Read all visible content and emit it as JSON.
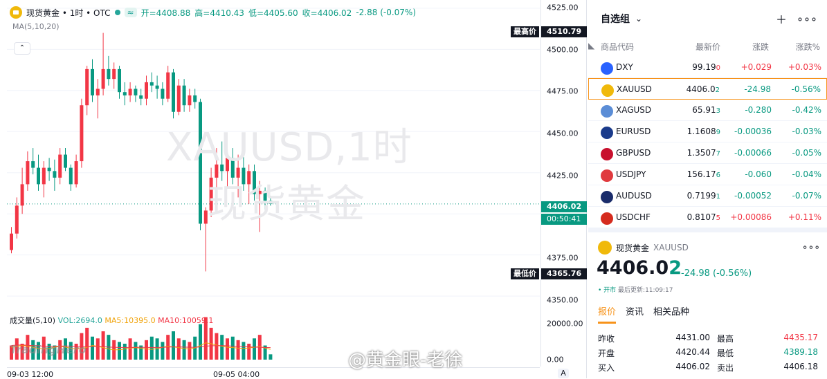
{
  "legend": {
    "title": "现货黄金 • 1时 • OTC",
    "badge": "≈",
    "open": "开=4408.88",
    "high": "高=4410.43",
    "low": "低=4405.60",
    "close": "收=4406.02",
    "change": "-2.88 (-0.07%)"
  },
  "ma_label": "MA(5,10,20)",
  "collapse": "⌃",
  "watermark": {
    "line1": "XAUUSD,1时",
    "line2": "现货黄金"
  },
  "price_axis": {
    "ticks": [
      "4525.00",
      "4500.00",
      "4475.00",
      "4450.00",
      "4425.00",
      "4375.00",
      "4350.00"
    ],
    "high_label": "最高价",
    "high_value": "4510.79",
    "last_value": "4406.02",
    "countdown": "00:50:41",
    "low_label": "最低价",
    "low_value": "4365.76",
    "vol_ticks": [
      "20000.00",
      "0.00"
    ]
  },
  "volume_legend": {
    "title": "成交量(5,10)",
    "vol": "VOL:2694.0",
    "ma5": "MA5:10395.0",
    "ma10": "MA10:10059.1"
  },
  "time_axis": [
    "09-03 12:00",
    "09-05 04:00"
  ],
  "tv_logo": "TradingHero",
  "weibo": "@黄金眼-老徐",
  "axis_button": "A",
  "colors": {
    "up": "#f23645",
    "down": "#089981",
    "accent": "#f7931a"
  },
  "chart_data": {
    "type": "candlestick",
    "symbol": "XAUUSD",
    "timeframe": "1时",
    "ylim": [
      4345,
      4530
    ],
    "candles": [
      {
        "o": 4378,
        "h": 4392,
        "l": 4376,
        "c": 4388
      },
      {
        "o": 4388,
        "h": 4410,
        "l": 4385,
        "c": 4405
      },
      {
        "o": 4405,
        "h": 4428,
        "l": 4400,
        "c": 4418
      },
      {
        "o": 4418,
        "h": 4438,
        "l": 4414,
        "c": 4432
      },
      {
        "o": 4432,
        "h": 4440,
        "l": 4424,
        "c": 4428
      },
      {
        "o": 4428,
        "h": 4436,
        "l": 4414,
        "c": 4418
      },
      {
        "o": 4418,
        "h": 4432,
        "l": 4410,
        "c": 4428
      },
      {
        "o": 4428,
        "h": 4434,
        "l": 4420,
        "c": 4426
      },
      {
        "o": 4426,
        "h": 4433,
        "l": 4414,
        "c": 4422
      },
      {
        "o": 4422,
        "h": 4440,
        "l": 4418,
        "c": 4436
      },
      {
        "o": 4436,
        "h": 4440,
        "l": 4426,
        "c": 4428
      },
      {
        "o": 4428,
        "h": 4430,
        "l": 4414,
        "c": 4418
      },
      {
        "o": 4418,
        "h": 4436,
        "l": 4416,
        "c": 4432
      },
      {
        "o": 4432,
        "h": 4470,
        "l": 4428,
        "c": 4466
      },
      {
        "o": 4466,
        "h": 4490,
        "l": 4460,
        "c": 4488
      },
      {
        "o": 4488,
        "h": 4494,
        "l": 4468,
        "c": 4472
      },
      {
        "o": 4472,
        "h": 4482,
        "l": 4458,
        "c": 4476
      },
      {
        "o": 4476,
        "h": 4510,
        "l": 4472,
        "c": 4488
      },
      {
        "o": 4488,
        "h": 4496,
        "l": 4478,
        "c": 4482
      },
      {
        "o": 4482,
        "h": 4492,
        "l": 4476,
        "c": 4488
      },
      {
        "o": 4488,
        "h": 4490,
        "l": 4470,
        "c": 4474
      },
      {
        "o": 4474,
        "h": 4480,
        "l": 4466,
        "c": 4472
      },
      {
        "o": 4472,
        "h": 4480,
        "l": 4468,
        "c": 4476
      },
      {
        "o": 4476,
        "h": 4478,
        "l": 4468,
        "c": 4472
      },
      {
        "o": 4472,
        "h": 4476,
        "l": 4466,
        "c": 4470
      },
      {
        "o": 4470,
        "h": 4484,
        "l": 4466,
        "c": 4480
      },
      {
        "o": 4480,
        "h": 4486,
        "l": 4474,
        "c": 4478
      },
      {
        "o": 4478,
        "h": 4484,
        "l": 4470,
        "c": 4476
      },
      {
        "o": 4476,
        "h": 4480,
        "l": 4466,
        "c": 4470
      },
      {
        "o": 4470,
        "h": 4490,
        "l": 4468,
        "c": 4486
      },
      {
        "o": 4486,
        "h": 4488,
        "l": 4458,
        "c": 4462
      },
      {
        "o": 4462,
        "h": 4482,
        "l": 4460,
        "c": 4478
      },
      {
        "o": 4478,
        "h": 4482,
        "l": 4462,
        "c": 4466
      },
      {
        "o": 4466,
        "h": 4476,
        "l": 4462,
        "c": 4472
      },
      {
        "o": 4472,
        "h": 4476,
        "l": 4464,
        "c": 4468
      },
      {
        "o": 4468,
        "h": 4470,
        "l": 4390,
        "c": 4394
      },
      {
        "o": 4394,
        "h": 4404,
        "l": 4365,
        "c": 4402
      },
      {
        "o": 4402,
        "h": 4428,
        "l": 4398,
        "c": 4422
      },
      {
        "o": 4422,
        "h": 4440,
        "l": 4414,
        "c": 4430
      },
      {
        "o": 4430,
        "h": 4444,
        "l": 4420,
        "c": 4426
      },
      {
        "o": 4426,
        "h": 4438,
        "l": 4416,
        "c": 4434
      },
      {
        "o": 4434,
        "h": 4440,
        "l": 4418,
        "c": 4422
      },
      {
        "o": 4422,
        "h": 4436,
        "l": 4410,
        "c": 4428
      },
      {
        "o": 4428,
        "h": 4436,
        "l": 4414,
        "c": 4418
      },
      {
        "o": 4418,
        "h": 4430,
        "l": 4406,
        "c": 4426
      },
      {
        "o": 4426,
        "h": 4430,
        "l": 4408,
        "c": 4412
      },
      {
        "o": 4412,
        "h": 4420,
        "l": 4389,
        "c": 4414
      },
      {
        "o": 4414,
        "h": 4416,
        "l": 4402,
        "c": 4408
      },
      {
        "o": 4408,
        "h": 4411,
        "l": 4405,
        "c": 4406
      }
    ],
    "volume": [
      8,
      12,
      9,
      14,
      11,
      10,
      13,
      9,
      8,
      11,
      12,
      10,
      9,
      15,
      18,
      13,
      12,
      16,
      14,
      11,
      10,
      9,
      12,
      10,
      8,
      11,
      13,
      12,
      10,
      14,
      16,
      12,
      11,
      10,
      13,
      20,
      24,
      18,
      15,
      14,
      12,
      13,
      11,
      10,
      9,
      12,
      14,
      8,
      3
    ],
    "ma5": [
      7,
      7.5,
      8,
      7.6,
      7,
      6.4,
      6,
      6.3,
      7,
      7.5,
      7.1,
      6.5,
      6,
      6.2,
      7,
      8,
      7.5,
      6.8,
      6,
      5.5,
      5.6,
      6,
      6.5,
      6.8,
      6.4,
      6,
      5.8,
      6.2,
      7,
      7.5,
      7.2,
      6.8,
      6.2,
      6,
      6.6,
      8,
      9.5,
      9,
      8.2,
      7.5,
      7,
      6.8,
      6.5,
      6.3,
      6.6,
      7,
      7.4,
      6.5,
      5.8
    ],
    "ma10": [
      8,
      8.2,
      8.3,
      8.1,
      7.9,
      7.8,
      7.6,
      7.5,
      7.5,
      7.6,
      7.7,
      7.6,
      7.5,
      7.3,
      7.3,
      7.4,
      7.5,
      7.3,
      7.1,
      7,
      6.9,
      6.9,
      6.9,
      7,
      7,
      6.9,
      6.9,
      6.9,
      7,
      7.1,
      7.2,
      7.2,
      7.1,
      7,
      7,
      7.2,
      7.6,
      7.8,
      7.9,
      7.9,
      7.8,
      7.6,
      7.4,
      7.3,
      7.2,
      7.1,
      7,
      6.9,
      6.8
    ]
  },
  "watchlist": {
    "title": "自选组",
    "columns": {
      "symbol": "商品代码",
      "price": "最新价",
      "change": "涨跌",
      "pct": "涨跌%"
    },
    "rows": [
      {
        "symbol": "DXY",
        "price": "99.19",
        "price_tail": "0",
        "change": "+0.029",
        "pct": "+0.03%",
        "dir": "up",
        "flag_color": "#2962ff"
      },
      {
        "symbol": "XAUUSD",
        "price": "4406.0",
        "price_tail": "2",
        "change": "-24.98",
        "pct": "-0.56%",
        "dir": "dn",
        "flag_color": "#f0b90b"
      },
      {
        "symbol": "XAGUSD",
        "price": "65.91",
        "price_tail": "3",
        "change": "-0.280",
        "pct": "-0.42%",
        "dir": "dn",
        "flag_color": "#5b8dd6"
      },
      {
        "symbol": "EURUSD",
        "price": "1.1608",
        "price_tail": "9",
        "change": "-0.00036",
        "pct": "-0.03%",
        "dir": "dn",
        "flag_color": "#1a3b8b"
      },
      {
        "symbol": "GBPUSD",
        "price": "1.3507",
        "price_tail": "7",
        "change": "-0.00066",
        "pct": "-0.05%",
        "dir": "dn",
        "flag_color": "#c8102e"
      },
      {
        "symbol": "USDJPY",
        "price": "156.17",
        "price_tail": "6",
        "change": "-0.060",
        "pct": "-0.04%",
        "dir": "dn",
        "flag_color": "#e03a3e"
      },
      {
        "symbol": "AUDUSD",
        "price": "0.7199",
        "price_tail": "1",
        "change": "-0.00052",
        "pct": "-0.07%",
        "dir": "dn",
        "flag_color": "#1a2c6b"
      },
      {
        "symbol": "USDCHF",
        "price": "0.8107",
        "price_tail": "5",
        "change": "+0.00086",
        "pct": "+0.11%",
        "dir": "up",
        "flag_color": "#d52b1e"
      }
    ]
  },
  "detail": {
    "name": "现货黄金",
    "symbol": "XAUUSD",
    "price_main": "4406.0",
    "price_last": "2",
    "change": "-24.98 (-0.56%)",
    "status": "• 开市",
    "updated": "最后更新:11:09:17",
    "tabs": [
      "报价",
      "资讯",
      "相关品种"
    ],
    "stats": [
      {
        "label": "昨收",
        "value": "4431.00",
        "label2": "最高",
        "value2": "4435.17"
      },
      {
        "label": "开盘",
        "value": "4420.44",
        "label2": "最低",
        "value2": "4389.18"
      },
      {
        "label": "买入",
        "value": "4406.02",
        "label2": "卖出",
        "value2": "4406.18"
      }
    ]
  }
}
